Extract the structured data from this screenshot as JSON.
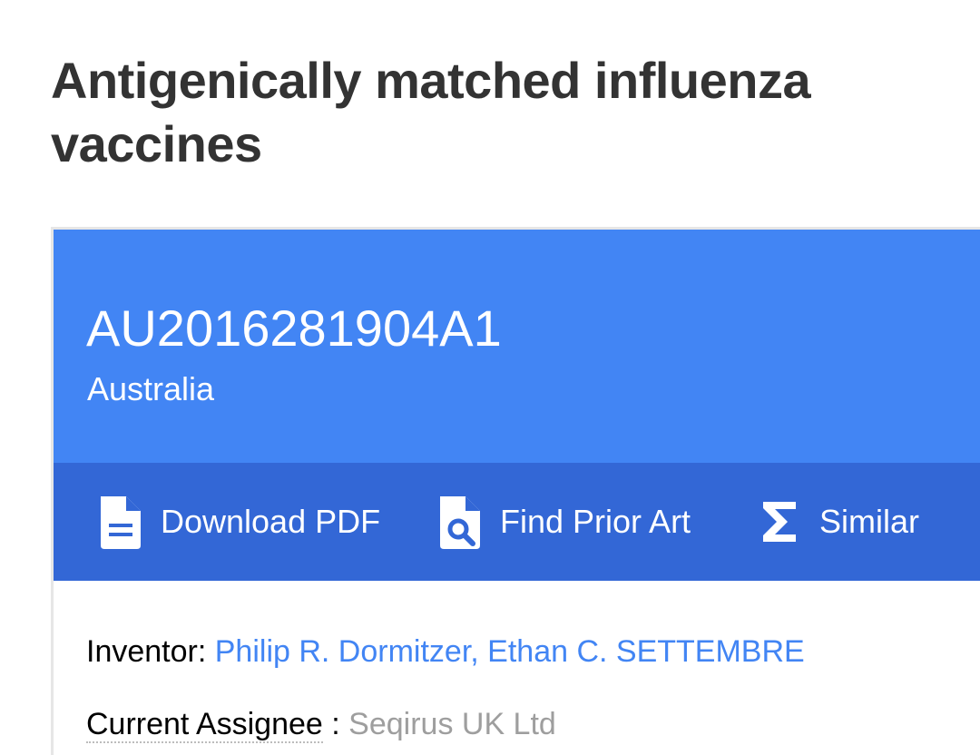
{
  "patent": {
    "title": "Antigenically matched influenza vaccines",
    "publication_number": "AU2016281904A1",
    "country": "Australia"
  },
  "toolbar": {
    "download_pdf": {
      "label": "Download PDF",
      "icon": "pdf-document-icon"
    },
    "find_prior_art": {
      "label": "Find Prior Art",
      "icon": "search-document-icon"
    },
    "similar": {
      "label": "Similar",
      "icon": "sigma-icon"
    }
  },
  "metadata": {
    "inventor_label": "Inventor:",
    "inventors": [
      "Philip R. Dormitzer",
      "Ethan C. SETTEMBRE"
    ],
    "inventor_separator": ", ",
    "assignee_label": "Current Assignee",
    "assignee_colon": " : ",
    "assignee_value": "Seqirus UK Ltd"
  },
  "colors": {
    "header_blue": "#4285f4",
    "toolbar_blue": "#3367d6",
    "link_blue": "#4285f4",
    "muted_gray": "#9e9e9e",
    "title_text": "#333333"
  }
}
